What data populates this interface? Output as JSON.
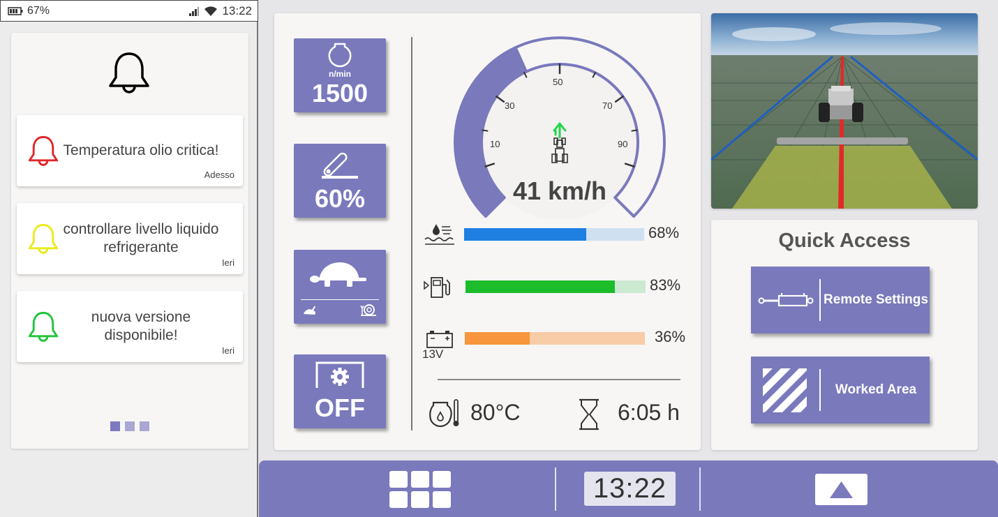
{
  "status_bar": {
    "battery": "67%",
    "time": "13:22",
    "icons": [
      "battery-icon",
      "signal-icon",
      "wifi-icon"
    ]
  },
  "notifications": {
    "header_icon": "bell-icon",
    "items": [
      {
        "text": "Temperatura olio critica!",
        "time": "Adesso",
        "color": "#e0262a"
      },
      {
        "text": "controllare livello liquido refrigerante",
        "time": "Ieri",
        "color": "#eaea1c"
      },
      {
        "text": "nuova versione disponibile!",
        "time": "Ieri",
        "color": "#22c43a"
      }
    ],
    "pager": {
      "pages": 3,
      "active": 1
    }
  },
  "tiles": {
    "rpm": {
      "unit": "n/min",
      "value": "1500",
      "icon": "engine-icon"
    },
    "throttle": {
      "value": "60%",
      "icon": "throttle-lever-icon"
    },
    "speed_mode": {
      "icon": "turtle-icon",
      "fast_icon": "rabbit-icon",
      "slow_icon": "snail-icon"
    },
    "pto": {
      "value": "OFF",
      "icon": "gear-icon"
    }
  },
  "speedometer": {
    "speed": 41,
    "label": "41 km/h",
    "ticks": [
      "10",
      "30",
      "50",
      "70",
      "90"
    ],
    "color": "#7a79bc"
  },
  "gauges": [
    {
      "name": "coolant",
      "icon": "coolant-icon",
      "value": 68,
      "label": "68%",
      "fill": "#1e7fe0",
      "track": "#cfe0f1"
    },
    {
      "name": "fuel",
      "icon": "fuel-icon",
      "value": 83,
      "label": "83%",
      "fill": "#1cbc2a",
      "track": "#cce9d2"
    },
    {
      "name": "battery",
      "icon": "car-battery-icon",
      "sublabel": "13V",
      "value": 36,
      "label": "36%",
      "fill": "#f7963c",
      "track": "#f7cca6"
    }
  ],
  "bottom_stats": {
    "oil_temp": "80°C",
    "engine_hours": "6:05 h"
  },
  "quick_access": {
    "title": "Quick Access",
    "buttons": [
      {
        "label": "Remote Settings",
        "icon": "hydraulic-cylinder-icon"
      },
      {
        "label": "Worked Area",
        "icon": "stripes-icon"
      }
    ]
  },
  "bottom_bar": {
    "clock": "13:22",
    "menu_icon": "grid-icon",
    "up_icon": "triangle-up-icon"
  }
}
